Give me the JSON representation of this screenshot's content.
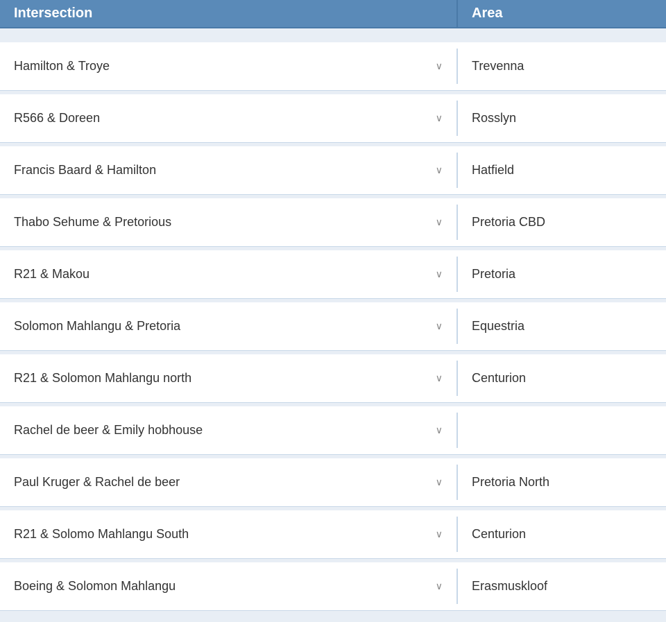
{
  "header": {
    "intersection_label": "Intersection",
    "area_label": "Area"
  },
  "rows": [
    {
      "intersection": "Hamilton & Troye",
      "area": "Trevenna"
    },
    {
      "intersection": "R566 & Doreen",
      "area": "Rosslyn"
    },
    {
      "intersection": "Francis Baard & Hamilton",
      "area": "Hatfield"
    },
    {
      "intersection": "Thabo Sehume & Pretorious",
      "area": "Pretoria  CBD"
    },
    {
      "intersection": "R21 & Makou",
      "area": "Pretoria"
    },
    {
      "intersection": "Solomon Mahlangu & Pretoria",
      "area": "Equestria"
    },
    {
      "intersection": "R21 & Solomon Mahlangu north",
      "area": "Centurion"
    },
    {
      "intersection": "Rachel de beer & Emily hobhouse",
      "area": ""
    },
    {
      "intersection": "Paul Kruger & Rachel de beer",
      "area": "Pretoria  North"
    },
    {
      "intersection": "R21 & Solomo Mahlangu South",
      "area": "Centurion"
    },
    {
      "intersection": "Boeing & Solomon Mahlangu",
      "area": "Erasmuskloof"
    }
  ],
  "icons": {
    "chevron": "∨"
  }
}
